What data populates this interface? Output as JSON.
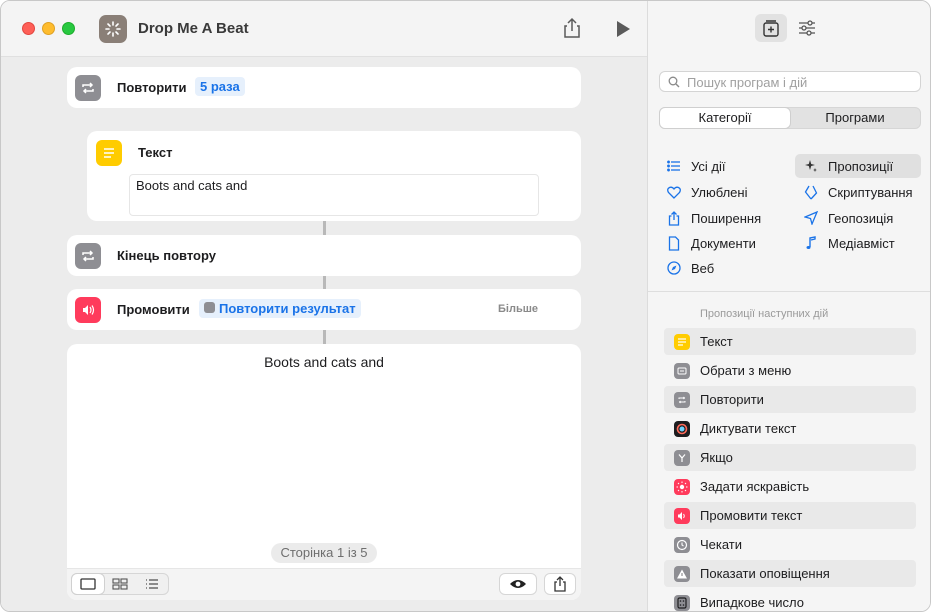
{
  "window": {
    "title": "Drop Me A Beat"
  },
  "actions": {
    "repeat": {
      "label": "Повторити",
      "token": "5 раза"
    },
    "text": {
      "label": "Текст",
      "value": "Boots and cats and"
    },
    "end_repeat": {
      "label": "Кінець повтору"
    },
    "speak": {
      "label": "Промовити",
      "token": "Повторити результат",
      "more": "Більше"
    }
  },
  "preview": {
    "text": "Boots and cats and",
    "page_indicator": "Сторінка 1 із 5"
  },
  "sidebar": {
    "search_placeholder": "Пошук програм і дій",
    "tabs": [
      {
        "label": "Категорії",
        "selected": true
      },
      {
        "label": "Програми",
        "selected": false
      }
    ],
    "categories_left": [
      {
        "label": "Усі дії",
        "icon": "list-icon"
      },
      {
        "label": "Улюблені",
        "icon": "heart-icon"
      },
      {
        "label": "Поширення",
        "icon": "share-icon"
      },
      {
        "label": "Документи",
        "icon": "document-icon"
      },
      {
        "label": "Веб",
        "icon": "compass-icon"
      }
    ],
    "categories_right": [
      {
        "label": "Пропозиції",
        "icon": "sparkle-icon",
        "selected": true
      },
      {
        "label": "Скриптування",
        "icon": "scripting-icon"
      },
      {
        "label": "Геопозиція",
        "icon": "location-arrow-icon"
      },
      {
        "label": "Медіавміст",
        "icon": "music-note-icon"
      }
    ],
    "suggestions_header": "Пропозиції наступних дій",
    "suggestions": [
      {
        "label": "Текст",
        "icon": "text-icon",
        "color": "#ffcc00"
      },
      {
        "label": "Обрати з меню",
        "icon": "menu-icon",
        "color": "#8e8e93"
      },
      {
        "label": "Повторити",
        "icon": "repeat-icon",
        "color": "#8e8e93"
      },
      {
        "label": "Диктувати текст",
        "icon": "dictate-icon",
        "color": "#1d1d1f"
      },
      {
        "label": "Якщо",
        "icon": "branch-icon",
        "color": "#8e8e93"
      },
      {
        "label": "Задати яскравість",
        "icon": "brightness-icon",
        "color": "#ff3b30"
      },
      {
        "label": "Промовити текст",
        "icon": "speaker-icon",
        "color": "#ff3b5c"
      },
      {
        "label": "Чекати",
        "icon": "clock-icon",
        "color": "#8e8e93"
      },
      {
        "label": "Показати оповіщення",
        "icon": "alert-icon",
        "color": "#8e8e93"
      },
      {
        "label": "Випадкове число",
        "icon": "dice-icon",
        "color": "#8e8e93"
      }
    ]
  }
}
